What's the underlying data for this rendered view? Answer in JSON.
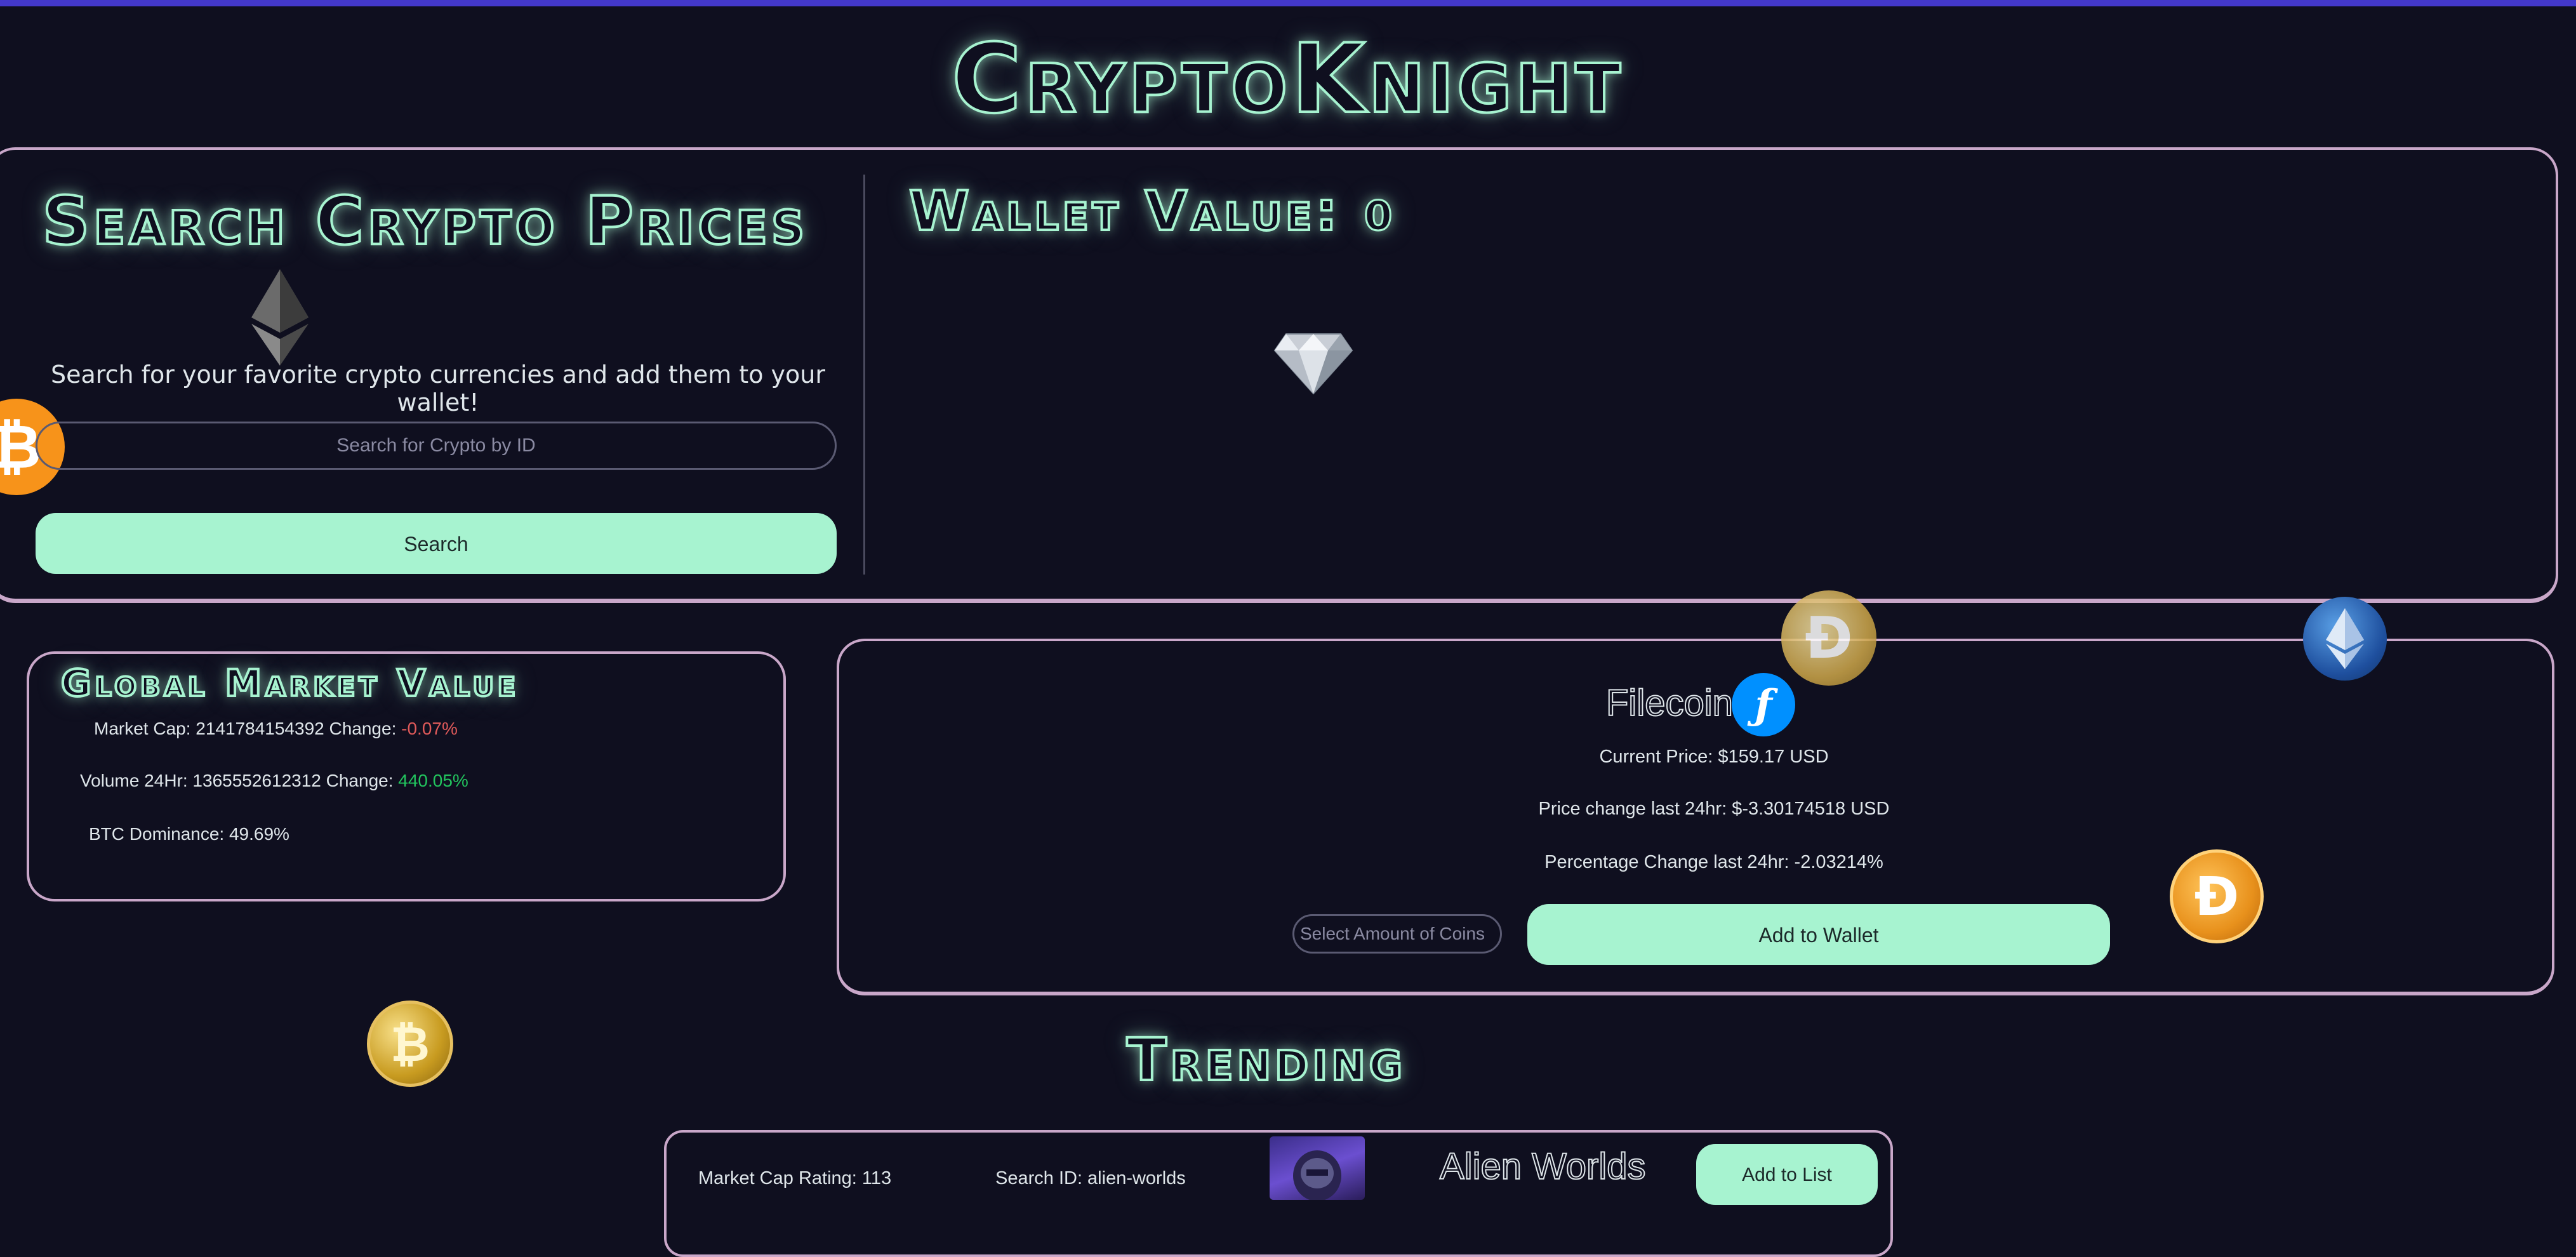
{
  "app": {
    "title": "CryptoKnight"
  },
  "search": {
    "title": "Search Crypto Prices",
    "description": "Search for your favorite crypto currencies and add them to your wallet!",
    "placeholder": "Search for Crypto by ID",
    "button_label": "Search"
  },
  "wallet": {
    "title_label": "Wallet Value:",
    "value": "0"
  },
  "global_market": {
    "title": "Global Market Value",
    "market_cap_label": "Market Cap: 2141784154392 Change:",
    "market_cap_change": "-0.07%",
    "volume_label": "Volume 24Hr: 1365552612312 Change:",
    "volume_change": "440.05%",
    "btc_dominance": "BTC Dominance: 49.69%"
  },
  "coin": {
    "name": "Filecoin",
    "current_price": "Current Price: $159.17 USD",
    "price_change": "Price change last 24hr: $-3.30174518 USD",
    "percent_change": "Percentage Change last 24hr: -2.03214%",
    "amount_placeholder": "Select Amount of Coins",
    "add_button_label": "Add to Wallet"
  },
  "trending": {
    "title": "Trending",
    "items": [
      {
        "market_cap_rating": "Market Cap Rating: 113",
        "search_id": "Search ID: alien-worlds",
        "name": "Alien Worlds",
        "button_label": "Add to List"
      }
    ]
  },
  "icons": {
    "btc_glyph": "₿",
    "doge_glyph": "Ð",
    "fil_glyph": "ƒ"
  },
  "colors": {
    "background": "#0f0f1f",
    "accent": "#a7f3d0",
    "top_bar": "#4338ca",
    "panel_border": "#c9a7c9",
    "negative": "#e05a5a",
    "positive": "#22c55e"
  }
}
